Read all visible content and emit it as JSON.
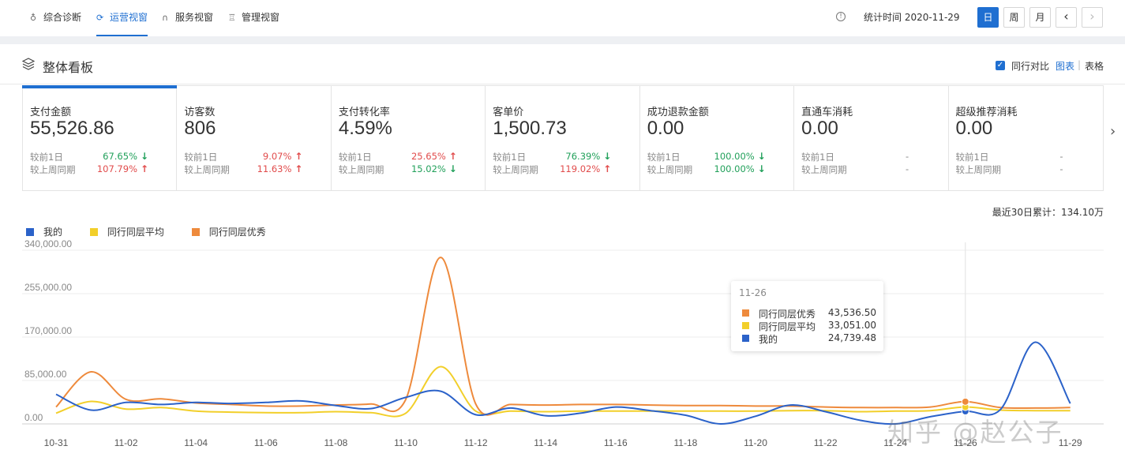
{
  "nav": {
    "tabs": [
      {
        "label": "综合诊断",
        "icon": "bulb-icon"
      },
      {
        "label": "运营视窗",
        "icon": "loop-icon",
        "active": true
      },
      {
        "label": "服务视窗",
        "icon": "headset-icon"
      },
      {
        "label": "管理视窗",
        "icon": "medal-icon"
      }
    ],
    "stat_time": "统计时间 2020-11-29",
    "periods": [
      "日",
      "周",
      "月"
    ],
    "active_period": "日",
    "prev": "‹",
    "next": "›"
  },
  "panel": {
    "title": "整体看板",
    "compare_label": "同行对比",
    "view_chart": "图表",
    "view_sep": "|",
    "view_table": "表格"
  },
  "cards": [
    {
      "title": "支付金额",
      "value": "55,526.86",
      "r1_label": "较前1日",
      "r1_pct": "67.65%",
      "r1_dir": "down",
      "r2_label": "较上周同期",
      "r2_pct": "107.79%",
      "r2_dir": "up",
      "active": true
    },
    {
      "title": "访客数",
      "value": "806",
      "r1_label": "较前1日",
      "r1_pct": "9.07%",
      "r1_dir": "up",
      "r2_label": "较上周同期",
      "r2_pct": "11.63%",
      "r2_dir": "up"
    },
    {
      "title": "支付转化率",
      "value": "4.59%",
      "r1_label": "较前1日",
      "r1_pct": "25.65%",
      "r1_dir": "up",
      "r2_label": "较上周同期",
      "r2_pct": "15.02%",
      "r2_dir": "down"
    },
    {
      "title": "客单价",
      "value": "1,500.73",
      "r1_label": "较前1日",
      "r1_pct": "76.39%",
      "r1_dir": "down",
      "r2_label": "较上周同期",
      "r2_pct": "119.02%",
      "r2_dir": "up"
    },
    {
      "title": "成功退款金额",
      "value": "0.00",
      "r1_label": "较前1日",
      "r1_pct": "100.00%",
      "r1_dir": "down",
      "r2_label": "较上周同期",
      "r2_pct": "100.00%",
      "r2_dir": "down"
    },
    {
      "title": "直通车消耗",
      "value": "0.00",
      "r1_label": "较前1日",
      "r1_pct": "-",
      "r1_dir": "flat",
      "r2_label": "较上周同期",
      "r2_pct": "-",
      "r2_dir": "flat"
    },
    {
      "title": "超级推荐消耗",
      "value": "0.00",
      "r1_label": "较前1日",
      "r1_pct": "-",
      "r1_dir": "flat",
      "r2_label": "较上周同期",
      "r2_pct": "-",
      "r2_dir": "flat"
    }
  ],
  "cumulative": "最近30日累计：134.10万",
  "colors": {
    "mine": "#2b62c9",
    "avg": "#f2cf2a",
    "excellent": "#ee8a3c",
    "accent": "#1f6fd1"
  },
  "chart_data": {
    "type": "line",
    "x": [
      "10-31",
      "11-01",
      "11-02",
      "11-03",
      "11-04",
      "11-05",
      "11-06",
      "11-07",
      "11-08",
      "11-09",
      "11-10",
      "11-11",
      "11-12",
      "11-13",
      "11-14",
      "11-15",
      "11-16",
      "11-17",
      "11-18",
      "11-19",
      "11-20",
      "11-21",
      "11-22",
      "11-23",
      "11-24",
      "11-25",
      "11-26",
      "11-27",
      "11-28",
      "11-29"
    ],
    "x_tick_labels": [
      "10-31",
      "11-02",
      "11-04",
      "11-06",
      "11-08",
      "11-10",
      "11-12",
      "11-14",
      "11-16",
      "11-18",
      "11-20",
      "11-22",
      "11-24",
      "11-26",
      "11-29"
    ],
    "y_ticks": [
      "340,000.00",
      "255,000.00",
      "170,000.00",
      "85,000.00",
      "0.00"
    ],
    "ylim": [
      0,
      340000
    ],
    "series": [
      {
        "name": "我的",
        "color_key": "mine",
        "values": [
          58000,
          27000,
          42000,
          38000,
          42000,
          40000,
          42000,
          45000,
          36000,
          30000,
          52000,
          64000,
          18000,
          31000,
          16000,
          21000,
          33000,
          26000,
          17000,
          0,
          15000,
          37000,
          24000,
          7000,
          0,
          14000,
          24739,
          28000,
          160000,
          40000
        ]
      },
      {
        "name": "同行同层平均",
        "color_key": "avg",
        "values": [
          21000,
          44000,
          29000,
          32000,
          25000,
          23000,
          22000,
          22000,
          24000,
          22000,
          21000,
          112000,
          25000,
          25000,
          24000,
          25000,
          25000,
          25000,
          25000,
          25000,
          25000,
          26000,
          26000,
          24000,
          25000,
          26000,
          33051,
          27000,
          26000,
          26000
        ]
      },
      {
        "name": "同行同层优秀",
        "color_key": "excellent",
        "values": [
          33000,
          102000,
          48000,
          49000,
          41000,
          38000,
          35000,
          35000,
          37000,
          39000,
          48000,
          326000,
          39000,
          38000,
          37000,
          38000,
          38000,
          37000,
          36000,
          36000,
          35000,
          35000,
          33000,
          32000,
          32000,
          33000,
          43536,
          32000,
          31000,
          32000
        ]
      }
    ],
    "tooltip": {
      "date": "11-26",
      "rows": [
        {
          "name": "同行同层优秀",
          "value": "43,536.50",
          "color_key": "excellent"
        },
        {
          "name": "同行同层平均",
          "value": "33,051.00",
          "color_key": "avg"
        },
        {
          "name": "我的",
          "value": "24,739.48",
          "color_key": "mine"
        }
      ]
    }
  },
  "watermark": "知乎 @赵公子"
}
